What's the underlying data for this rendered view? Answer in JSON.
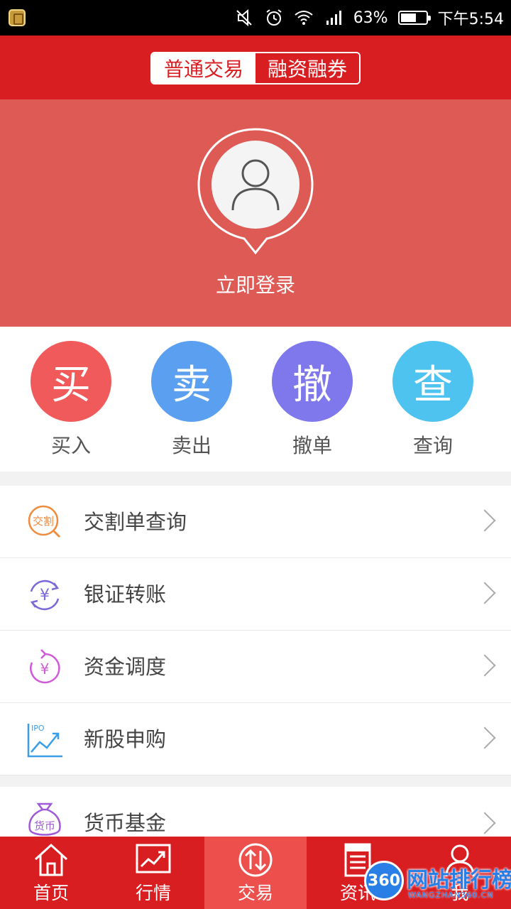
{
  "status_bar": {
    "battery_percent": "63%",
    "time": "下午5:54",
    "battery_level": 0.63
  },
  "header": {
    "tab_normal": "普通交易",
    "tab_margin": "融资融券"
  },
  "login": {
    "prompt": "立即登录"
  },
  "quick_actions": [
    {
      "glyph": "买",
      "label": "买入",
      "color": "#f05a5a"
    },
    {
      "glyph": "卖",
      "label": "卖出",
      "color": "#5a9ff0"
    },
    {
      "glyph": "撤",
      "label": "撤单",
      "color": "#7f78ec"
    },
    {
      "glyph": "查",
      "label": "查询",
      "color": "#4fc3f0"
    }
  ],
  "menu": [
    {
      "label": "交割单查询",
      "icon": "delivery-query-icon",
      "icon_text": "交割"
    },
    {
      "label": "银证转账",
      "icon": "bank-transfer-icon",
      "icon_text": "¥"
    },
    {
      "label": "资金调度",
      "icon": "fund-dispatch-icon",
      "icon_text": "¥"
    },
    {
      "label": "新股申购",
      "icon": "ipo-icon",
      "icon_text": "IPO"
    }
  ],
  "menu2": [
    {
      "label": "货币基金",
      "icon": "money-fund-icon",
      "icon_text": "货币"
    }
  ],
  "tabbar": [
    {
      "label": "首页",
      "icon": "home-icon"
    },
    {
      "label": "行情",
      "icon": "market-chart-icon"
    },
    {
      "label": "交易",
      "icon": "trade-icon"
    },
    {
      "label": "资讯",
      "icon": "news-icon"
    },
    {
      "label": "我",
      "icon": "user-icon"
    }
  ],
  "watermark": {
    "badge": "360",
    "name": "网站排行榜",
    "url": "WANGZHAN360.CN"
  }
}
